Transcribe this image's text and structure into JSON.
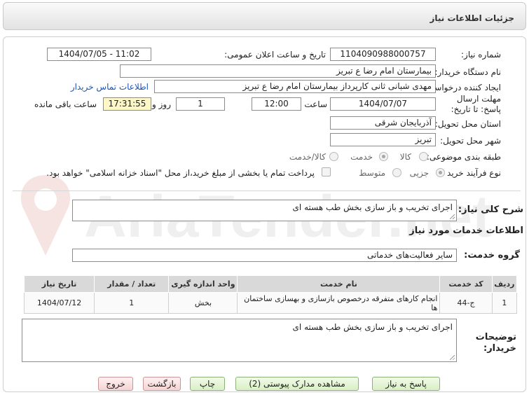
{
  "header": {
    "title": "جزئیات اطلاعات نیاز"
  },
  "form": {
    "need_number_label": "شماره نیاز:",
    "need_number": "1104090988000757",
    "announce_label": "تاریخ و ساعت اعلان عمومی:",
    "announce_value": "1404/07/05 - 11:02",
    "buyer_org_label": "نام دستگاه خریدار:",
    "buyer_org": "بیمارستان امام رضا  ع  تبریز",
    "creator_label": "ایجاد کننده درخواست:",
    "creator": "مهدی شبانی ثانی کارپرداز بیمارستان امام رضا  ع  تبریز",
    "contact_link": "اطلاعات تماس خریدار",
    "deadline_label": "مهلت ارسال پاسخ: تا تاریخ:",
    "deadline_date": "1404/07/07",
    "time_label": "ساعت",
    "deadline_time": "12:00",
    "days_value": "1",
    "days_label": "روز و",
    "remaining_time": "17:31:55",
    "remaining_label": "ساعت باقی مانده",
    "province_label": "استان محل تحویل:",
    "province": "آذربایجان شرقی",
    "city_label": "شهر محل تحویل:",
    "city": "تبریز",
    "category_label": "طبقه بندی موضوعی:",
    "category_options": [
      "کالا",
      "خدمت",
      "کالا/خدمت"
    ],
    "category_selected": 1,
    "process_label": "نوع فرآیند خرید :",
    "process_options": [
      "جزیی",
      "متوسط"
    ],
    "process_selected": 0,
    "payment_note": "پرداخت تمام یا بخشی از مبلغ خرید،از محل \"اسناد خزانه اسلامی\" خواهد بود."
  },
  "summary": {
    "label": "شرح کلی نیاز:",
    "value": "اجرای تخریب و باز سازی بخش طب هسته ای"
  },
  "services": {
    "section_title": "اطلاعات خدمات مورد نیاز",
    "group_label": "گروه خدمت:",
    "group_value": "سایر فعالیت‌های خدماتی",
    "columns": [
      "ردیف",
      "کد خدمت",
      "نام خدمت",
      "واحد اندازه گیری",
      "تعداد / مقدار",
      "تاریخ نیاز"
    ],
    "rows": [
      [
        "1",
        "ج-44",
        "انجام کارهای متفرقه درخصوص بازسازی و بهسازی ساختمان ها",
        "بخش",
        "1",
        "1404/07/12"
      ]
    ]
  },
  "buyer_notes": {
    "label": "توضیحات خریدار:",
    "value": "اجرای تخریب و باز سازی بخش طب هسته ای"
  },
  "buttons": {
    "reply": "پاسخ به نیاز",
    "attachments": "مشاهده مدارک پیوستی (2)",
    "print": "چاپ",
    "back": "بازگشت",
    "exit": "خروج"
  },
  "watermark": {
    "text": "AriaTender.net"
  }
}
